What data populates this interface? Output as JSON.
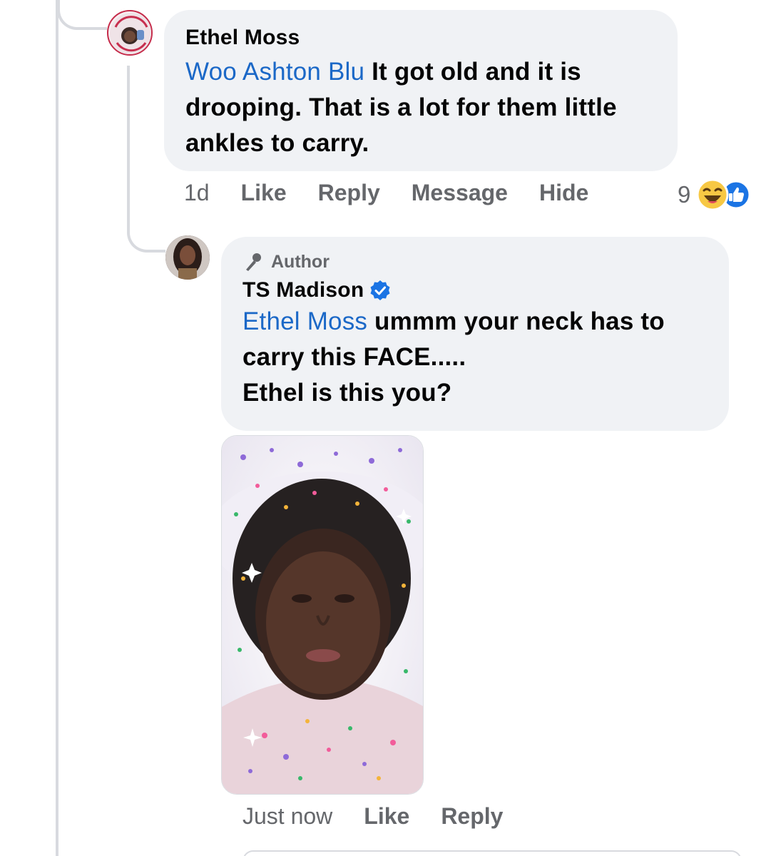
{
  "comment1": {
    "author": "Ethel Moss",
    "mention": "Woo Ashton Blu",
    "body": " It got old and it is drooping. That is a lot for them little ankles to carry.",
    "time": "1d",
    "actions": {
      "like": "Like",
      "reply": "Reply",
      "message": "Message",
      "hide": "Hide"
    },
    "reaction_count": "9",
    "avatar_icon": "avatar-photo",
    "reaction_icons": [
      "haha-icon",
      "like-icon"
    ]
  },
  "reply1": {
    "badge": "Author",
    "author": "TS Madison",
    "mention": "Ethel Moss",
    "body_line1": " ummm your neck has to carry this FACE.....",
    "body_line2": "Ethel is this you?",
    "time": "Just now",
    "actions": {
      "like": "Like",
      "reply": "Reply"
    },
    "badge_icon": "microphone-icon",
    "verified_icon": "verified-badge-icon",
    "avatar_icon": "avatar-photo",
    "photo_icon": "attached-photo"
  },
  "colors": {
    "bubble": "#f0f2f5",
    "mention": "#1b68c7",
    "meta": "#65676b",
    "verified": "#1b74e4",
    "thread_line": "#d8dadf"
  }
}
